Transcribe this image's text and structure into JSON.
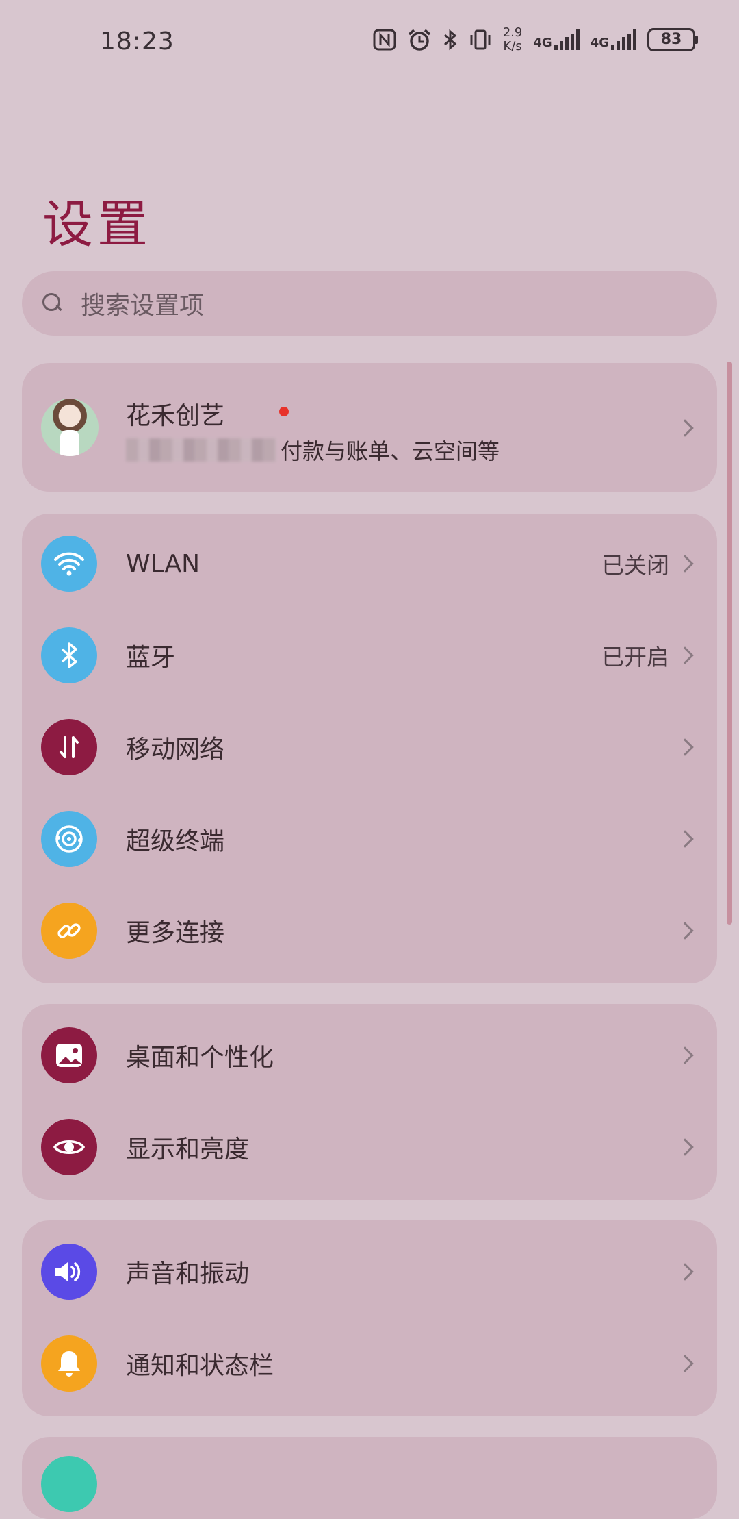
{
  "status_bar": {
    "time": "18:23",
    "net_speed_value": "2.9",
    "net_speed_unit": "K/s",
    "sim1_type": "4G",
    "sim2_type": "4G",
    "battery": "83",
    "icons": [
      "nfc-icon",
      "alarm-icon",
      "bluetooth-icon",
      "vibrate-icon"
    ]
  },
  "page": {
    "title": "设置"
  },
  "search": {
    "placeholder": "搜索设置项"
  },
  "account": {
    "name": "花禾创艺",
    "subtitle_visible": "付款与账单、云空间等",
    "has_notification_dot": true
  },
  "groups": [
    {
      "items": [
        {
          "label": "WLAN",
          "value": "已关闭",
          "icon": "wifi-icon",
          "color": "#4fb3e6"
        },
        {
          "label": "蓝牙",
          "value": "已开启",
          "icon": "bluetooth-icon",
          "color": "#4fb3e6"
        },
        {
          "label": "移动网络",
          "value": "",
          "icon": "mobile-data-icon",
          "color": "#8d1b42"
        },
        {
          "label": "超级终端",
          "value": "",
          "icon": "super-device-icon",
          "color": "#4fb3e6"
        },
        {
          "label": "更多连接",
          "value": "",
          "icon": "link-icon",
          "color": "#f5a41f"
        }
      ]
    },
    {
      "items": [
        {
          "label": "桌面和个性化",
          "value": "",
          "icon": "wallpaper-icon",
          "color": "#8d1b42"
        },
        {
          "label": "显示和亮度",
          "value": "",
          "icon": "eye-icon",
          "color": "#8d1b42"
        }
      ]
    },
    {
      "items": [
        {
          "label": "声音和振动",
          "value": "",
          "icon": "speaker-icon",
          "color": "#5a4ae6"
        },
        {
          "label": "通知和状态栏",
          "value": "",
          "icon": "bell-icon",
          "color": "#f5a41f"
        }
      ]
    }
  ],
  "partial_next_item": {
    "icon": "fingerprint-icon",
    "color": "#3dc9b0"
  }
}
